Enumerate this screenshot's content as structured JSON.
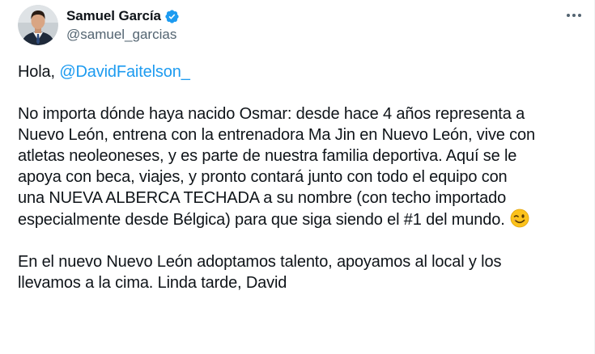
{
  "author": {
    "display_name": "Samuel García",
    "handle": "@samuel_garcias",
    "avatar_icon": "profile-photo",
    "verified": true,
    "verified_color": "#1d9bf0"
  },
  "menu": {
    "icon": "more-horizontal-icon"
  },
  "tweet": {
    "greeting": "Hola, ",
    "mention": "@DavidFaitelson_",
    "line1": "No importa dónde haya nacido Osmar: desde hace 4 años representa a",
    "line2": "Nuevo León, entrena con la entrenadora Ma Jin en Nuevo León, vive con",
    "line3": "atletas neoleoneses, y es parte de nuestra familia deportiva. Aquí se le",
    "line4": "apoya con beca, viajes, y pronto contará junto con todo el equipo con",
    "line5": "una NUEVA ALBERCA TECHADA a su nombre (con techo importado",
    "line6": "especialmente desde Bélgica) para que siga siendo el #1 del mundo. ",
    "emoji": "winking-face-emoji",
    "line7": "En el nuevo Nuevo León adoptamos talento, apoyamos al local y los",
    "line8": "llevamos a la cima. Linda tarde, David"
  },
  "colors": {
    "text": "#0f1419",
    "secondary": "#536471",
    "link": "#1d9bf0"
  }
}
